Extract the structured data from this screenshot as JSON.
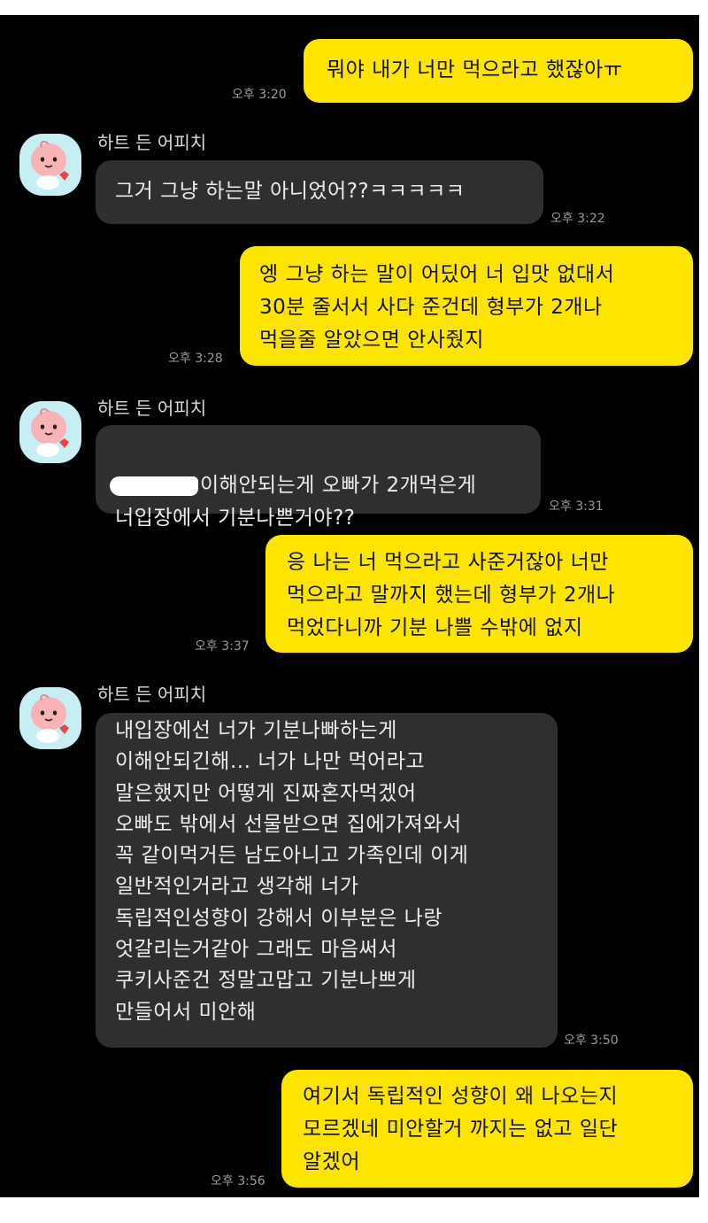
{
  "contact": {
    "name": "하트 든 어피치"
  },
  "colors": {
    "my_bubble": "#fee500",
    "their_bubble": "#2f2f2f",
    "background": "#000000"
  },
  "messages": [
    {
      "sender": "me",
      "time": "오후 3:20",
      "text": "뭐야 내가 너만 먹으라고 했잖아ㅠ"
    },
    {
      "sender": "them",
      "time": "오후 3:22",
      "text": "그거 그냥 하는말 아니었어??ㅋㅋㅋㅋㅋ"
    },
    {
      "sender": "me",
      "time": "오후 3:28",
      "text": "엥 그냥 하는 말이 어딨어 너 입맛 없대서\n30분 줄서서 사다 준건데 형부가 2개나\n먹을줄 알았으면 안사줬지"
    },
    {
      "sender": "them",
      "time": "오후 3:31",
      "text_after_redaction": "이해안되는게 오빠가 2개먹은게\n너입장에서 기분나쁜거야??"
    },
    {
      "sender": "me",
      "time": "오후 3:37",
      "text": "응 나는 너 먹으라고 사준거잖아 너만\n먹으라고 말까지 했는데 형부가 2개나\n먹었다니까 기분 나쁠 수밖에 없지"
    },
    {
      "sender": "them",
      "time": "오후 3:50",
      "text": "내입장에선 너가 기분나빠하는게\n이해안되긴해... 너가 나만 먹어라고\n말은했지만 어떻게 진짜혼자먹겠어\n오빠도 밖에서 선물받으면 집에가져와서\n꼭 같이먹거든 남도아니고 가족인데 이게\n일반적인거라고 생각해 너가\n독립적인성향이 강해서 이부분은 나랑\n엇갈리는거같아 그래도 마음써서\n쿠키사준건 정말고맙고 기분나쁘게\n만들어서 미안해"
    },
    {
      "sender": "me",
      "time": "오후 3:56",
      "text": "여기서 독립적인 성향이 왜 나오는지\n모르겠네 미안할거 까지는 없고 일단\n알겠어"
    }
  ]
}
